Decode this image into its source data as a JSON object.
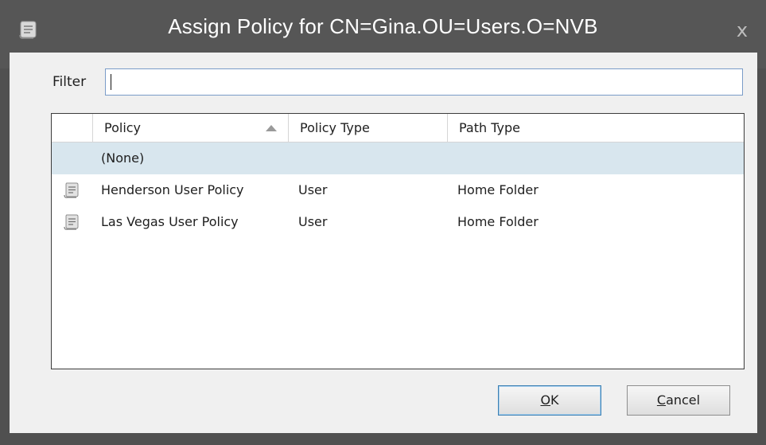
{
  "window": {
    "title": "Assign Policy for CN=Gina.OU=Users.O=NVB",
    "close_glyph": "x",
    "icon": "scroll-icon"
  },
  "filter": {
    "label": "Filter",
    "value": ""
  },
  "list": {
    "columns": [
      "Policy",
      "Policy Type",
      "Path Type"
    ],
    "sort_column": "Policy",
    "sort_direction": "ascending",
    "rows": [
      {
        "policy": "(None)",
        "policy_type": "",
        "path_type": "",
        "icon": null,
        "selected": true
      },
      {
        "policy": "Henderson User Policy",
        "policy_type": "User",
        "path_type": "Home Folder",
        "icon": "policy-scroll-icon",
        "selected": false
      },
      {
        "policy": "Las Vegas User Policy",
        "policy_type": "User",
        "path_type": "Home Folder",
        "icon": "policy-scroll-icon",
        "selected": false
      }
    ]
  },
  "buttons": {
    "ok_accel": "O",
    "ok_rest": "K",
    "cancel_accel": "C",
    "cancel_rest": "ancel"
  },
  "colors": {
    "titlebar": "#565656",
    "selection": "#d8e6ee",
    "input_border": "#7a9cc8"
  }
}
